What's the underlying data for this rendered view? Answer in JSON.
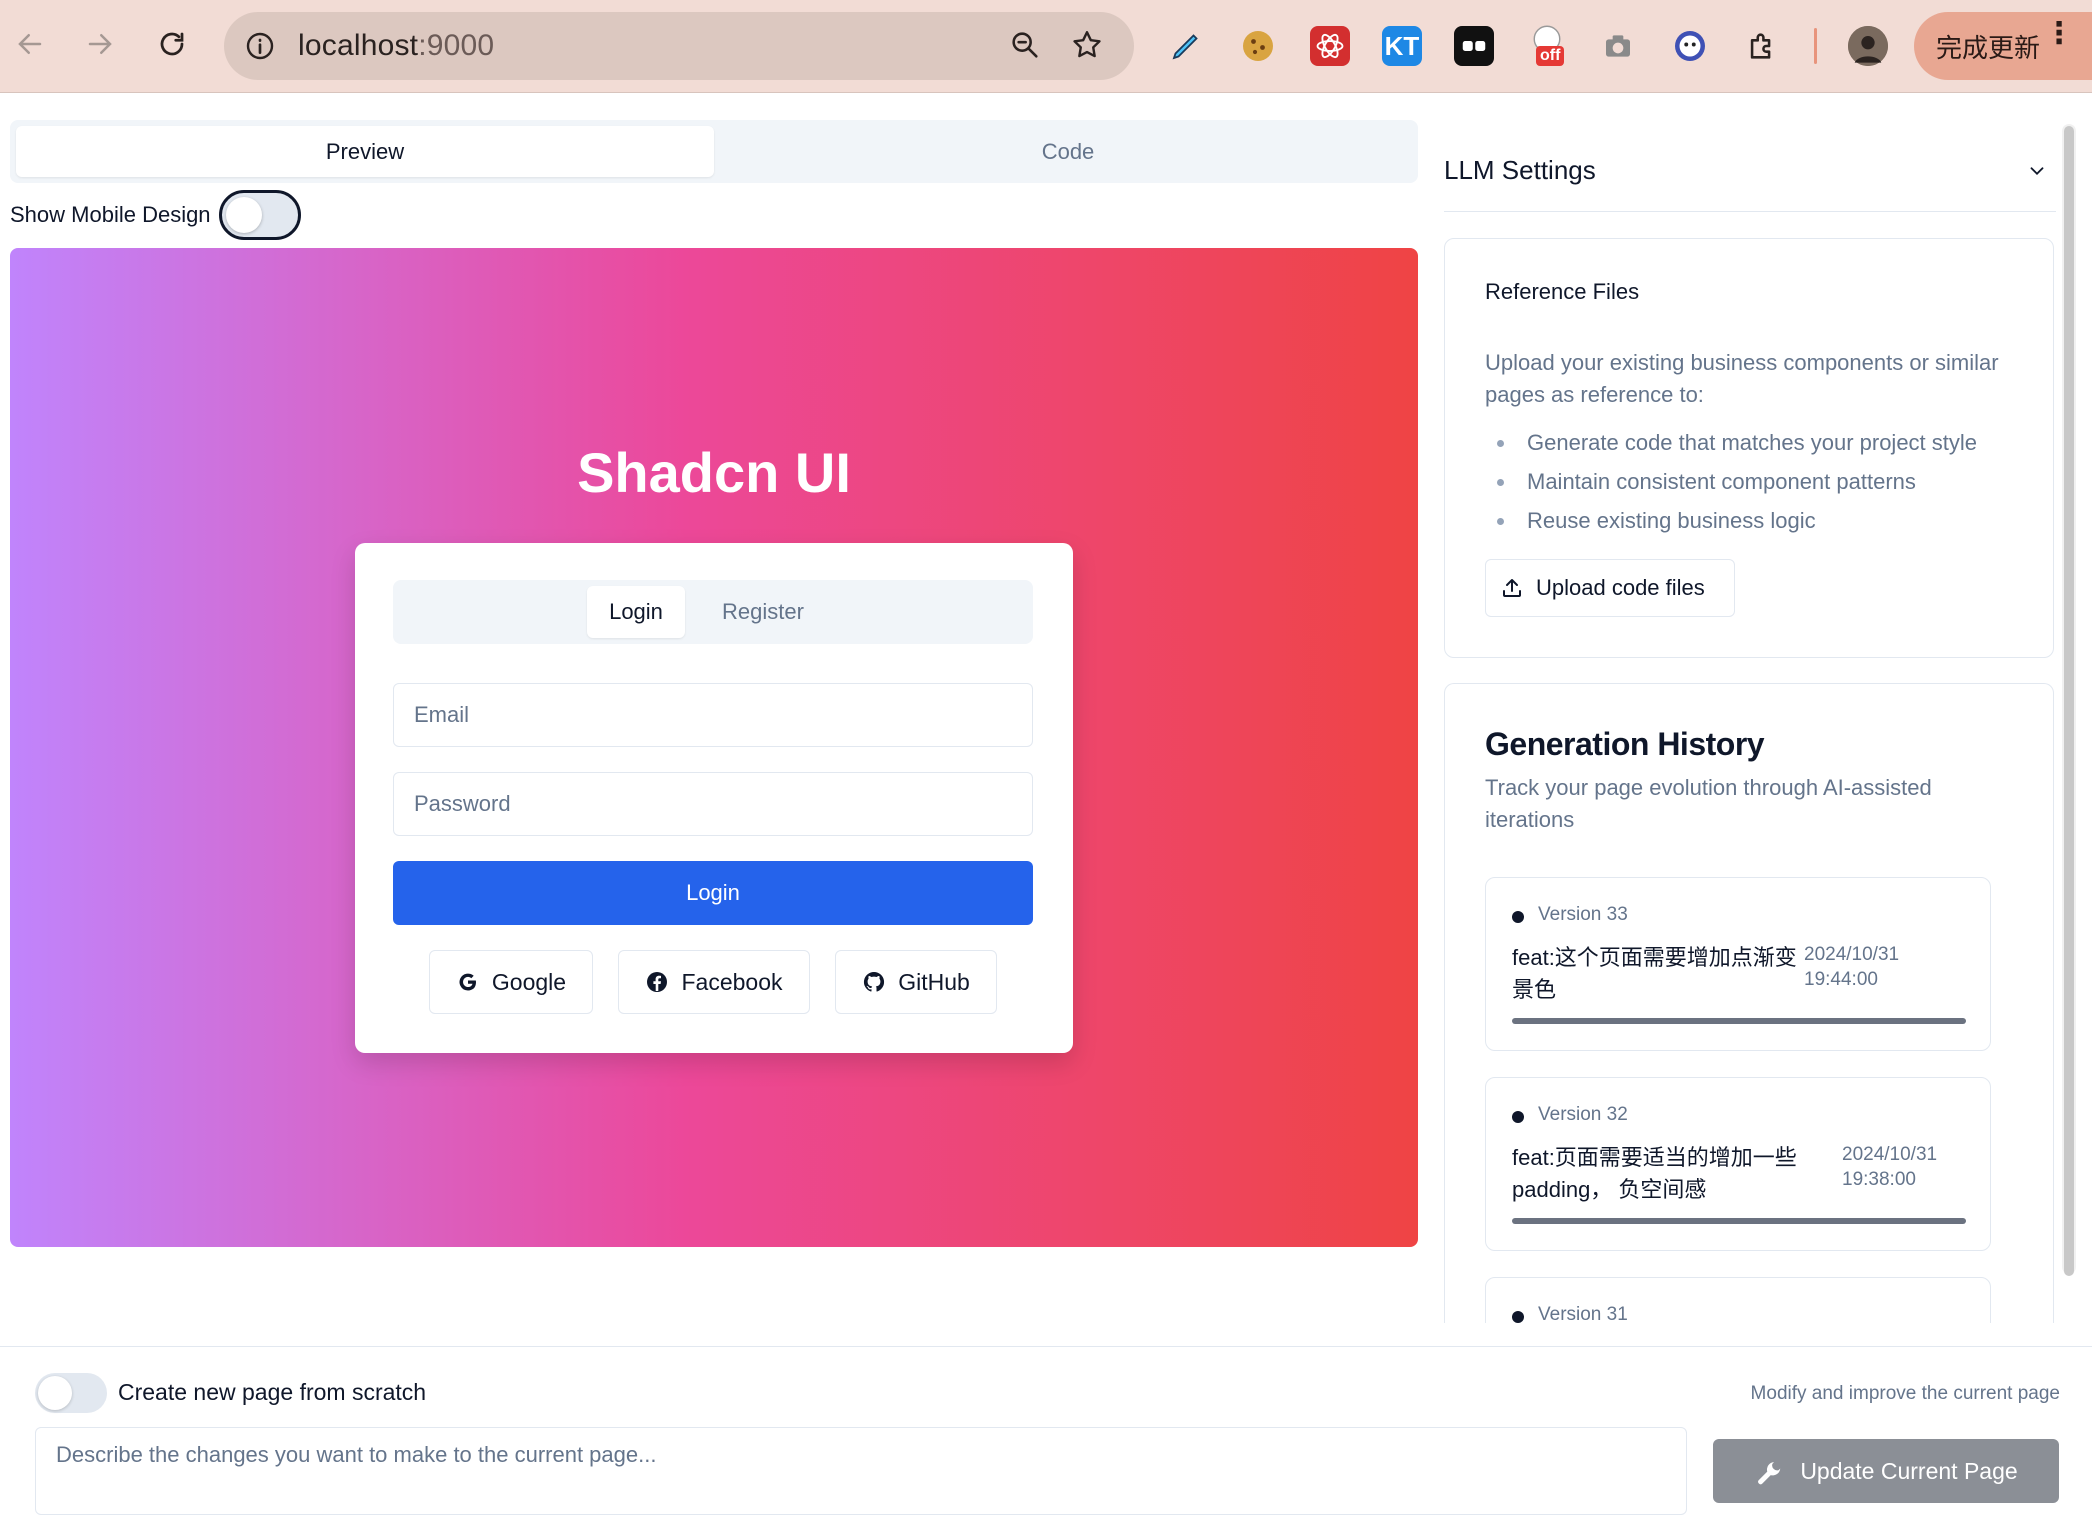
{
  "browser": {
    "url_host": "localhost",
    "url_port": ":9000",
    "update_label": "完成更新",
    "ext_kt_label": "KT",
    "ext_off_label": "off"
  },
  "tabs": [
    {
      "label": "Preview",
      "active": true
    },
    {
      "label": "Code",
      "active": false
    }
  ],
  "mobile_toggle": {
    "label": "Show Mobile Design",
    "on": false
  },
  "preview": {
    "brand": "Shadcn UI",
    "auth_tabs": [
      {
        "label": "Login",
        "active": true
      },
      {
        "label": "Register",
        "active": false
      }
    ],
    "email_placeholder": "Email",
    "password_placeholder": "Password",
    "login_button": "Login",
    "social": [
      {
        "label": "Google",
        "icon": "google-icon"
      },
      {
        "label": "Facebook",
        "icon": "facebook-icon"
      },
      {
        "label": "GitHub",
        "icon": "github-icon"
      }
    ],
    "gradient": [
      "#c084fc",
      "#ec4899",
      "#ef4444"
    ]
  },
  "llm_settings": {
    "title": "LLM Settings"
  },
  "reference_files": {
    "title": "Reference Files",
    "description": "Upload your existing business components or similar pages as reference to:",
    "items": [
      "Generate code that matches your project style",
      "Maintain consistent component patterns",
      "Reuse existing business logic"
    ],
    "upload_label": "Upload code files"
  },
  "history": {
    "title": "Generation History",
    "subtitle": "Track your page evolution through AI-assisted iterations",
    "versions": [
      {
        "name": "Version 33",
        "message": "feat:这个页面需要增加点渐变景色",
        "date": "2024/10/31",
        "time": "19:44:00",
        "progress": 1.0
      },
      {
        "name": "Version 32",
        "message": "feat:页面需要适当的增加一些padding， 负空间感",
        "date": "2024/10/31",
        "time": "19:38:00",
        "progress": 1.0
      },
      {
        "name": "Version 31"
      }
    ]
  },
  "bottom": {
    "scratch_label": "Create new page from scratch",
    "hint": "Modify and improve the current page",
    "prompt_placeholder": "Describe the changes you want to make to the current page...",
    "update_button": "Update Current Page"
  },
  "colors": {
    "primary": "#2563eb",
    "muted": "#64748b",
    "update_button": "#8b8f96"
  }
}
